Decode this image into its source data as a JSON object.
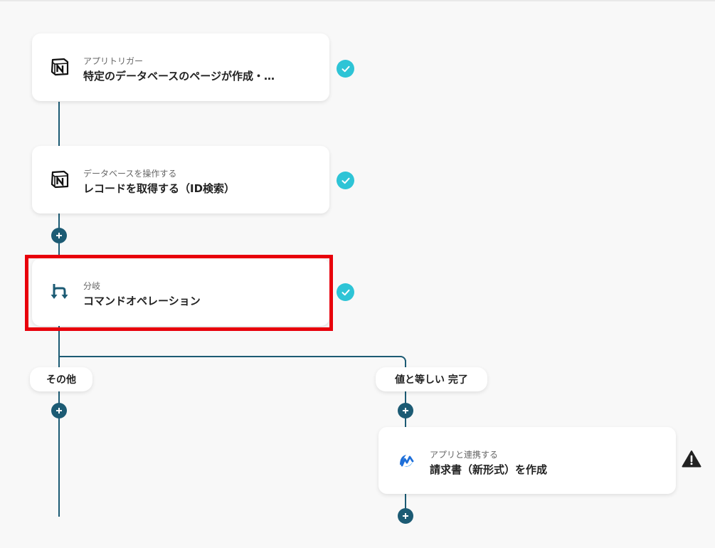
{
  "flow": {
    "steps": [
      {
        "subtitle": "アプリトリガー",
        "title": "特定のデータベースのページが作成・…",
        "icon": "notion-icon"
      },
      {
        "subtitle": "データベースを操作する",
        "title": "レコードを取得する（ID検索）",
        "icon": "notion-icon"
      },
      {
        "subtitle": "分岐",
        "title": "コマンドオペレーション",
        "icon": "branch-icon"
      }
    ],
    "branches": {
      "left_label": "その他",
      "right_label": "値と等しい 完了"
    },
    "branch_step": {
      "subtitle": "アプリと連携する",
      "title": "請求書（新形式）を作成",
      "icon": "moneyforward-icon"
    }
  },
  "colors": {
    "line": "#1c5b74",
    "check": "#2ec4d6",
    "highlight": "#e8000b"
  }
}
